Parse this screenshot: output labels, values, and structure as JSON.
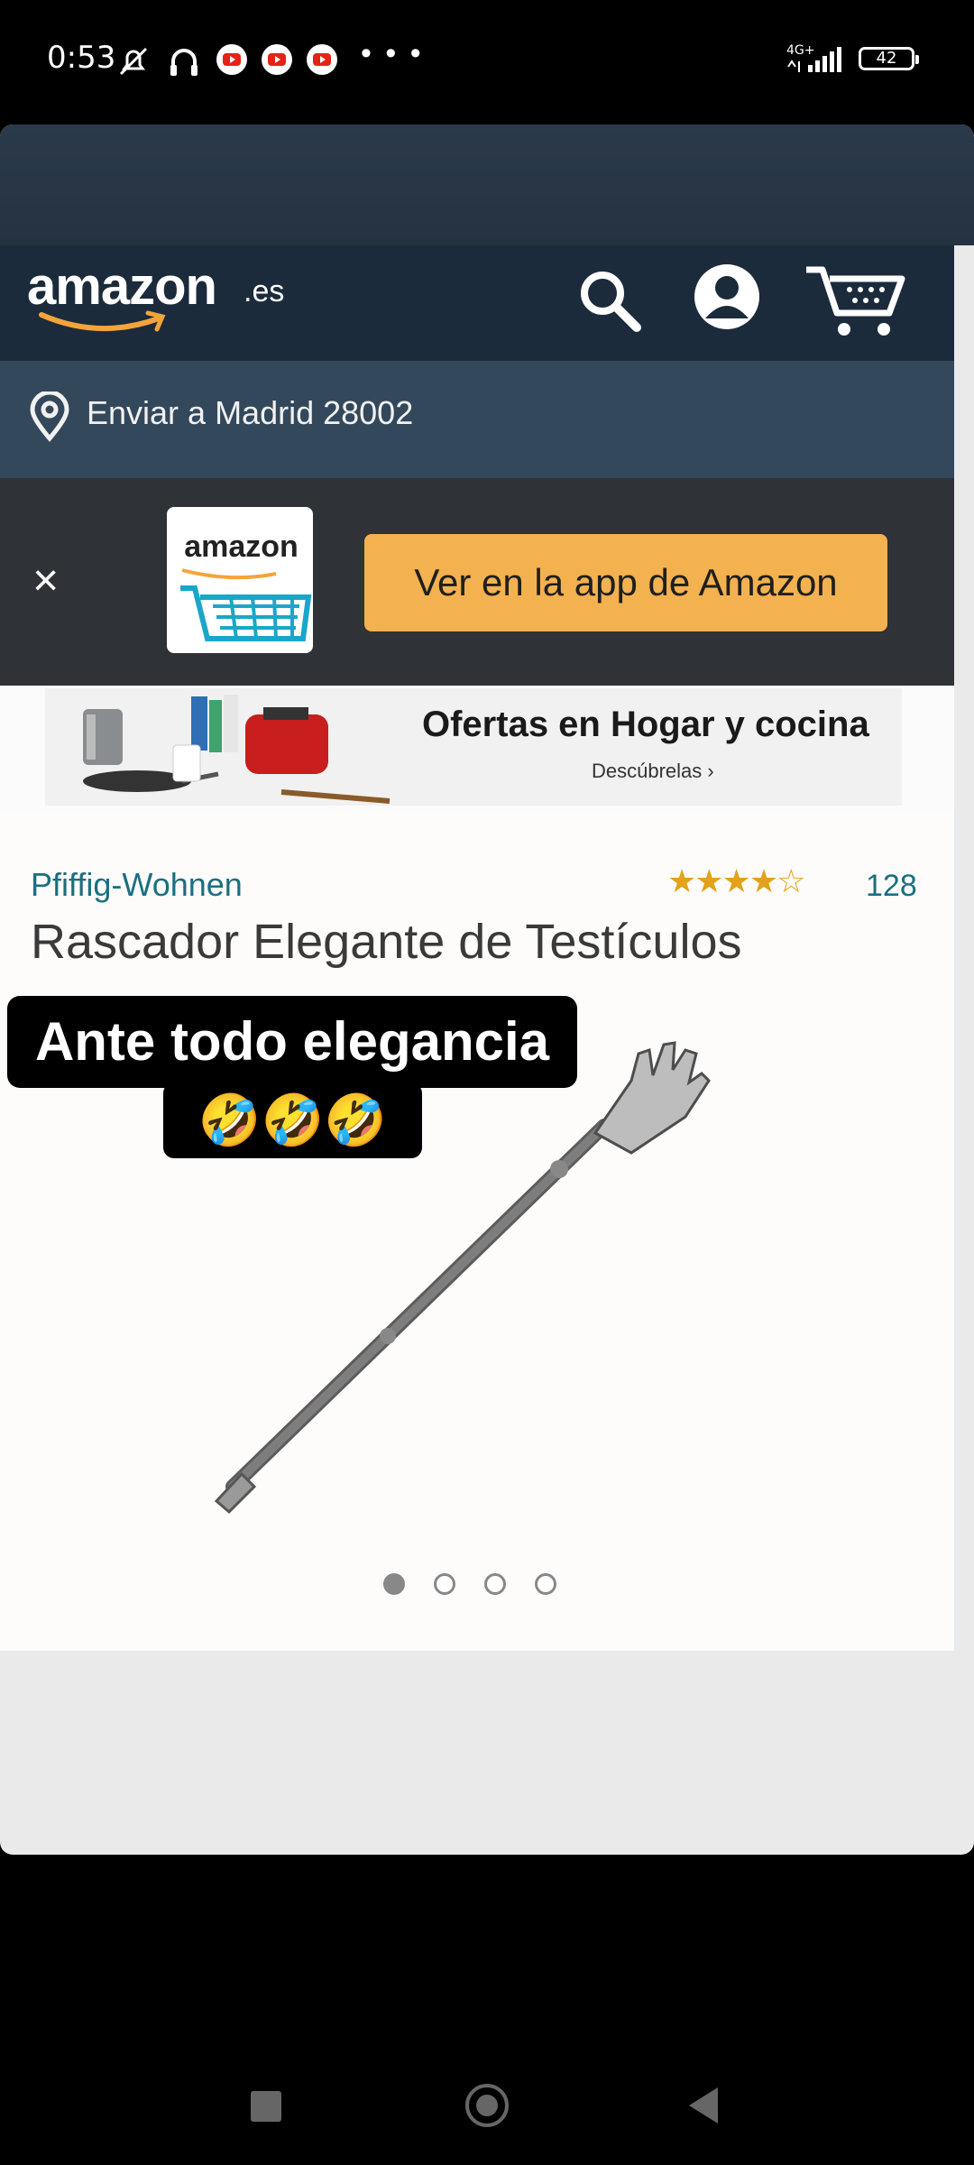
{
  "status_bar": {
    "time": "0:53",
    "icons": [
      "mute-icon",
      "headphones-icon",
      "youtube-icon",
      "youtube-icon",
      "youtube-icon",
      "more-notifications-icon"
    ],
    "more_dots": "• • •",
    "network": "4G+",
    "battery_level": "42"
  },
  "header": {
    "logo": "amazon",
    "logo_suffix": ".es",
    "icons": [
      "search-icon",
      "account-icon",
      "cart-icon"
    ]
  },
  "location": {
    "text": "Enviar a Madrid 28002",
    "icon": "location-pin-icon"
  },
  "app_banner": {
    "close_label": "×",
    "app_icon_label": "amazon",
    "button_label": "Ver en la app de Amazon"
  },
  "promo": {
    "title": "Ofertas en Hogar y cocina",
    "subtitle": "Descúbrelas ›"
  },
  "product": {
    "brand": "Pfiffig-Wohnen",
    "rating_stars": "★★★★☆",
    "rating_value": 4,
    "rating_count": "128",
    "title": "Rascador Elegante de Testículos",
    "image_carousel_count": 4,
    "active_image_index": 0
  },
  "caption": {
    "line1": "Ante todo elegancia",
    "line2": "🤣🤣🤣"
  },
  "navigation": {
    "icons": [
      "recents-icon",
      "home-icon",
      "back-icon"
    ]
  },
  "colors": {
    "header_bg": "#1c2b3b",
    "location_bg": "#34485b",
    "banner_bg": "#2f3236",
    "button_bg": "#f3b14f",
    "link_teal": "#1b6f80",
    "star_gold": "#e2a21b"
  }
}
